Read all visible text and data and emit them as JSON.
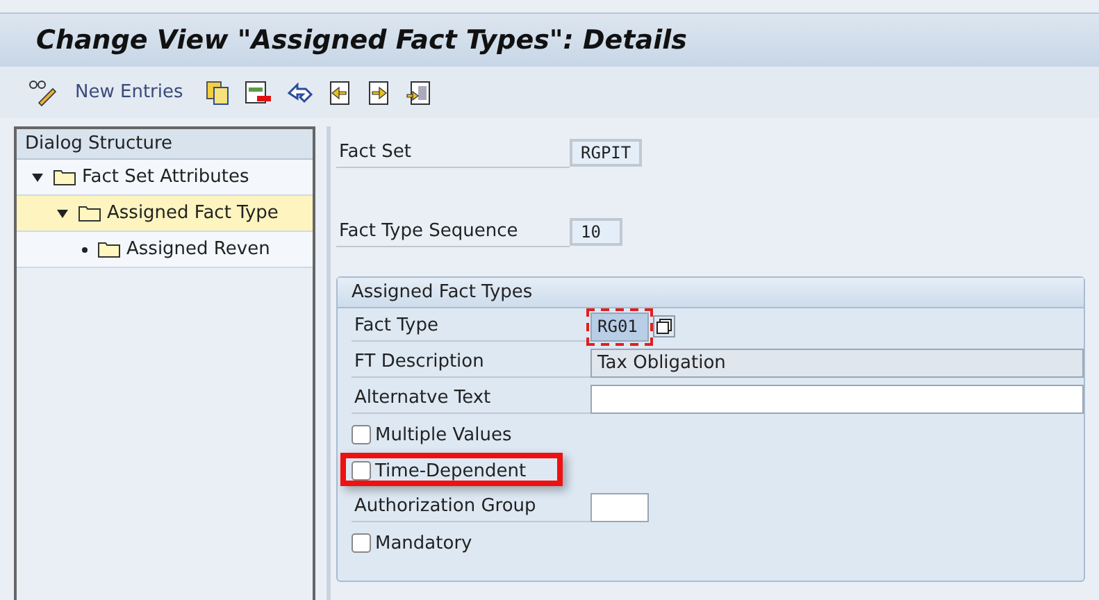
{
  "window": {
    "title": "Change View \"Assigned Fact Types\": Details"
  },
  "toolbar": {
    "items": [
      {
        "kind": "icon"
      },
      {
        "kind": "text",
        "label": "New Entries"
      },
      {
        "kind": "icon"
      },
      {
        "kind": "icon"
      },
      {
        "kind": "icon"
      },
      {
        "kind": "icon"
      },
      {
        "kind": "icon"
      },
      {
        "kind": "icon"
      }
    ]
  },
  "dialog_structure": {
    "title": "Dialog Structure",
    "items": [
      {
        "label": "Fact Set Attributes",
        "expanded": true,
        "selected": false,
        "children": [
          {
            "label": "Assigned Fact Type",
            "expanded": true,
            "selected": true,
            "children": [
              {
                "label": "Assigned Reven",
                "expanded": false,
                "selected": false
              }
            ]
          }
        ]
      }
    ]
  },
  "header_fields": [
    {
      "label": "Fact Set",
      "value": "RGPIT"
    },
    {
      "label": "Fact Type Sequence",
      "value": "10"
    }
  ],
  "group": {
    "title": "Assigned Fact Types",
    "rows": [
      {
        "kind": "code_field",
        "label": "Fact Type",
        "value": "RG01",
        "focused": true,
        "readonly": false,
        "value_help": true
      },
      {
        "kind": "text_field",
        "label": "FT Description",
        "value": "Tax Obligation",
        "focused": false,
        "readonly": true
      },
      {
        "kind": "text_field",
        "label": "Alternatve Text",
        "value": "",
        "focused": false,
        "readonly": false
      },
      {
        "kind": "checkbox",
        "label": "Multiple Values",
        "checked": false
      },
      {
        "kind": "checkbox",
        "label": "Time-Dependent",
        "checked": false,
        "highlighted": true
      },
      {
        "kind": "code_field",
        "label": "Authorization Group",
        "value": "",
        "focused": false,
        "readonly": false
      },
      {
        "kind": "checkbox",
        "label": "Mandatory",
        "checked": false
      }
    ]
  }
}
